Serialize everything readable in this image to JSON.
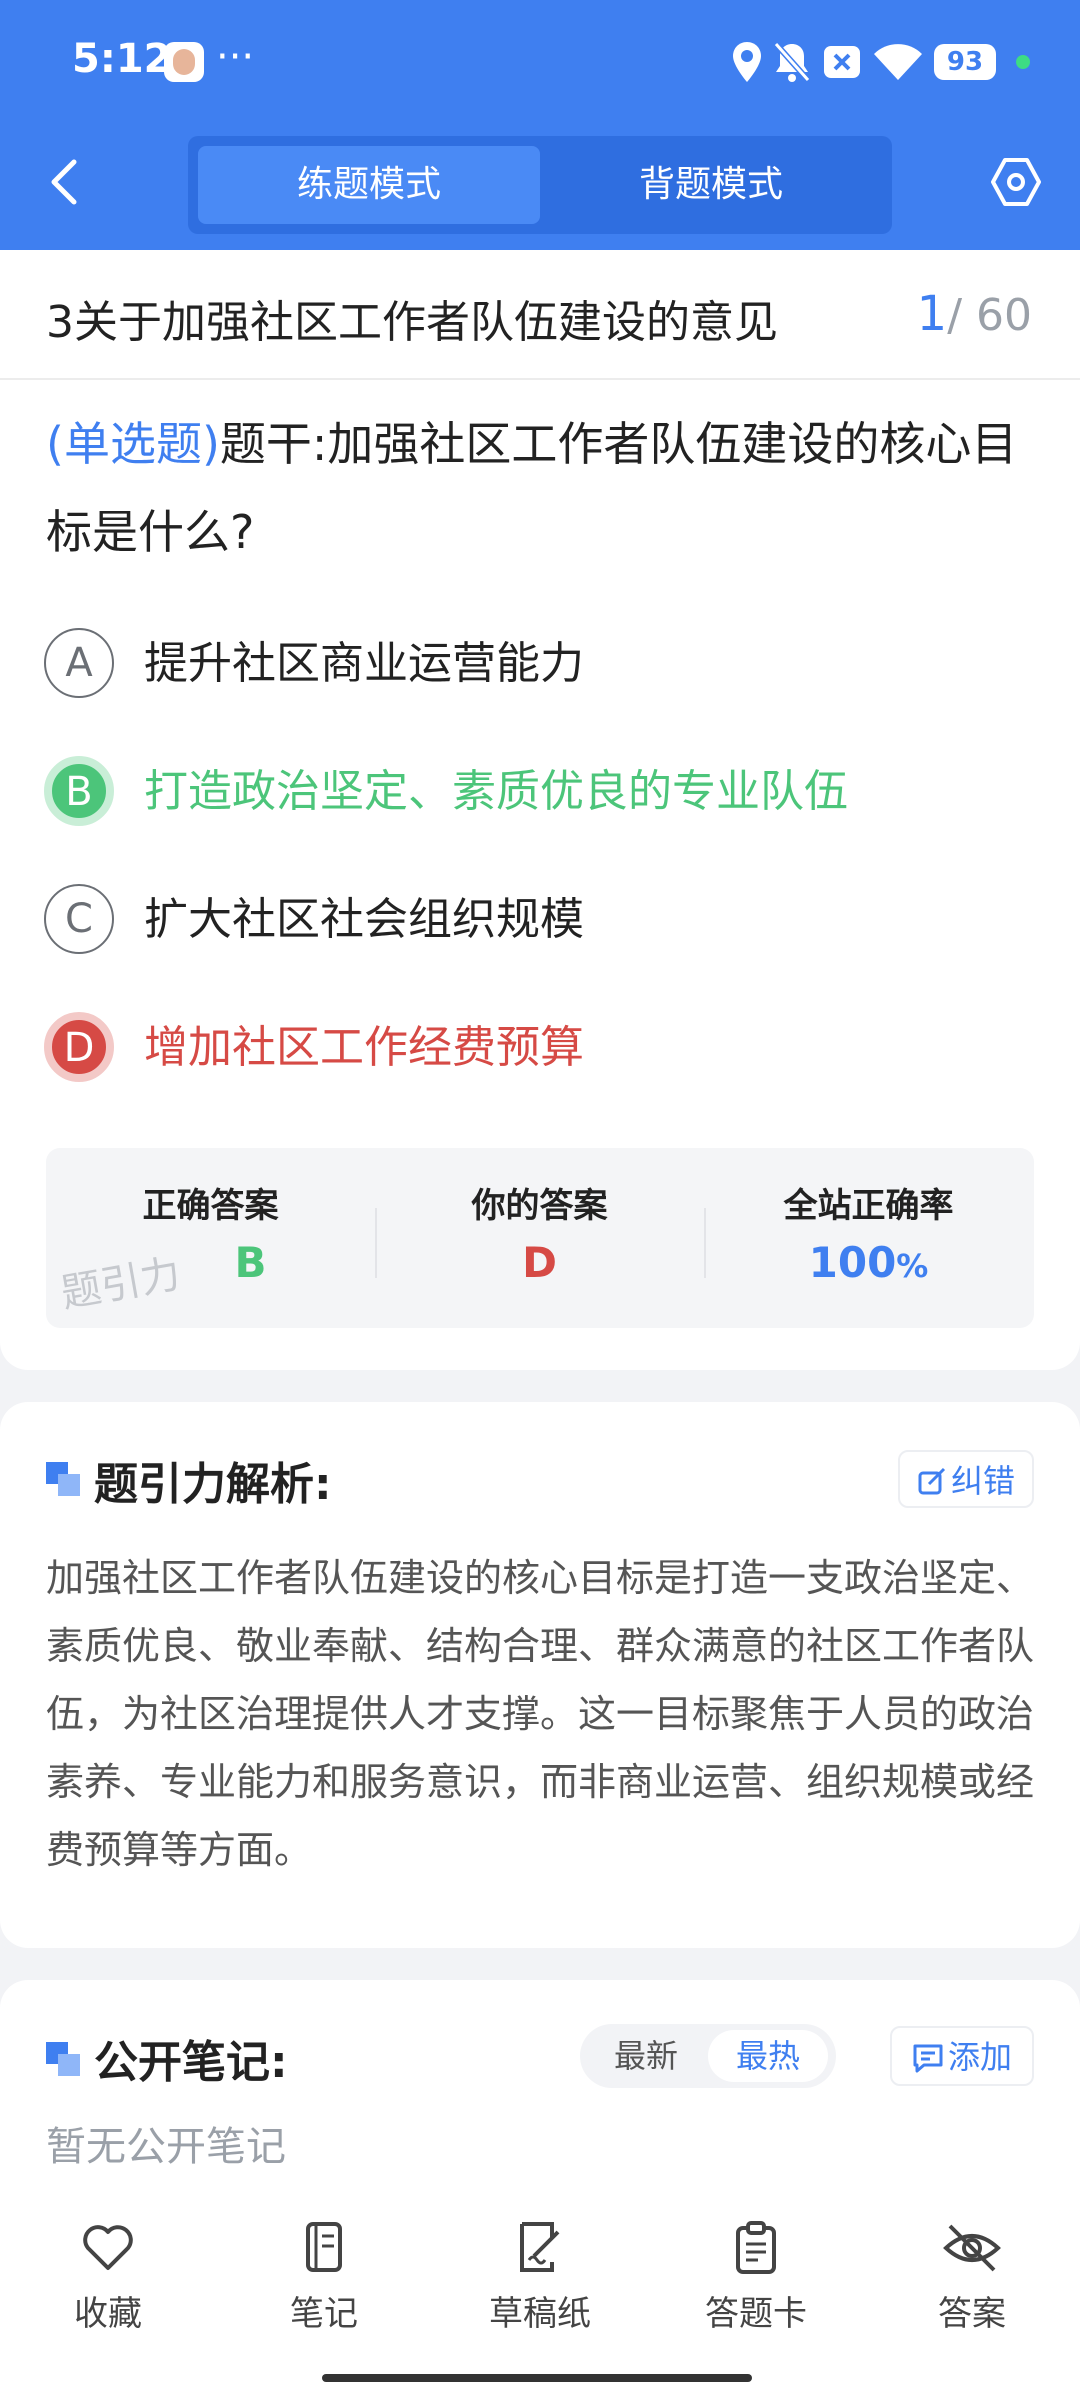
{
  "status_bar": {
    "time": "5:12",
    "dots": "···",
    "battery": "93"
  },
  "header": {
    "tabs": [
      "练题模式",
      "背题模式"
    ],
    "active_tab": 0
  },
  "question": {
    "title": "3关于加强社区工作者队伍建设的意见",
    "current": "1",
    "total": "/ 60",
    "type": "(单选题)",
    "stem": "题干:加强社区工作者队伍建设的核心目标是什么?",
    "options": [
      {
        "letter": "A",
        "text": "提升社区商业运营能力",
        "state": "normal"
      },
      {
        "letter": "B",
        "text": "打造政治坚定、素质优良的专业队伍",
        "state": "correct"
      },
      {
        "letter": "C",
        "text": "扩大社区社会组织规模",
        "state": "normal"
      },
      {
        "letter": "D",
        "text": "增加社区工作经费预算",
        "state": "wrong"
      }
    ]
  },
  "result": {
    "correct_label": "正确答案",
    "correct_value": "B",
    "yours_label": "你的答案",
    "yours_value": "D",
    "rate_label": "全站正确率",
    "rate_value": "100",
    "rate_unit": "%",
    "watermark": "题引力"
  },
  "analysis": {
    "title": "题引力解析:",
    "report_label": "纠错",
    "text": "加强社区工作者队伍建设的核心目标是打造一支政治坚定、素质优良、敬业奉献、结构合理、群众满意的社区工作者队伍，为社区治理提供人才支撑。这一目标聚焦于人员的政治素养、专业能力和服务意识，而非商业运营、组织规模或经费预算等方面。"
  },
  "notes": {
    "title": "公开笔记:",
    "sort_latest": "最新",
    "sort_hot": "最热",
    "add_label": "添加",
    "empty": "暂无公开笔记"
  },
  "bottom_tabs": [
    {
      "label": "收藏",
      "icon": "heart-icon"
    },
    {
      "label": "笔记",
      "icon": "notebook-icon"
    },
    {
      "label": "草稿纸",
      "icon": "draft-paper-icon"
    },
    {
      "label": "答题卡",
      "icon": "answer-card-icon"
    },
    {
      "label": "答案",
      "icon": "eye-off-icon"
    }
  ],
  "colors": {
    "primary": "#3f7ff0",
    "correct": "#4cc57a",
    "wrong": "#d64a45"
  }
}
